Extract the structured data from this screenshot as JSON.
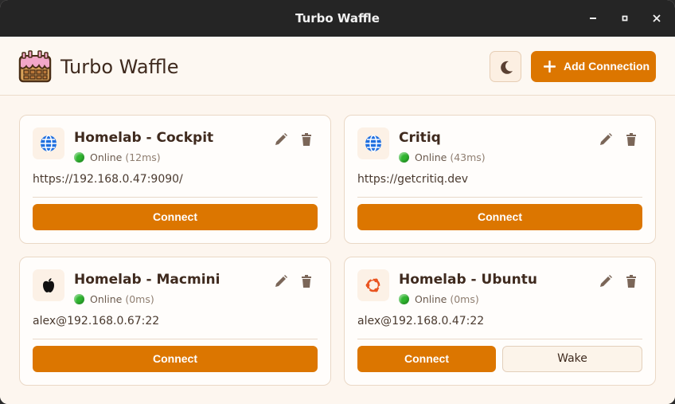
{
  "window": {
    "title": "Turbo Waffle"
  },
  "header": {
    "app_title": "Turbo Waffle",
    "add_button_label": "Add Connection"
  },
  "colors": {
    "accent": "#dc7600",
    "online": "#2fb52f",
    "text": "#3f2a1e"
  },
  "connections": [
    {
      "name": "Homelab - Cockpit",
      "icon": "globe-icon",
      "status": "Online",
      "latency": "(12ms)",
      "address": "https://192.168.0.47:9090/",
      "connect_label": "Connect"
    },
    {
      "name": "Critiq",
      "icon": "globe-icon",
      "status": "Online",
      "latency": "(43ms)",
      "address": "https://getcritiq.dev",
      "connect_label": "Connect"
    },
    {
      "name": "Homelab - Macmini",
      "icon": "apple-icon",
      "status": "Online",
      "latency": "(0ms)",
      "address": "alex@192.168.0.67:22",
      "connect_label": "Connect"
    },
    {
      "name": "Homelab - Ubuntu",
      "icon": "ubuntu-icon",
      "status": "Online",
      "latency": "(0ms)",
      "address": "alex@192.168.0.47:22",
      "connect_label": "Connect",
      "wake_label": "Wake"
    }
  ]
}
